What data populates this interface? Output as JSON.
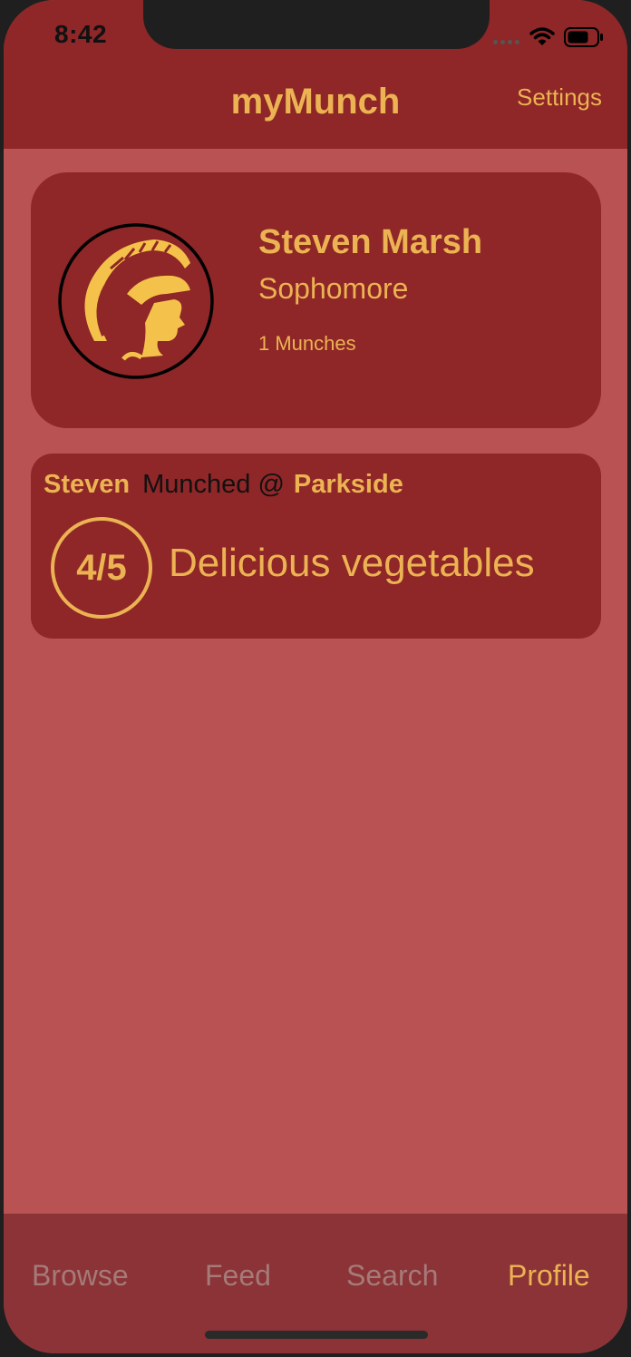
{
  "status_bar": {
    "time": "8:42"
  },
  "nav": {
    "title": "myMunch",
    "settings_label": "Settings"
  },
  "profile": {
    "name": "Steven Marsh",
    "year": "Sophomore",
    "munches": "1 Munches",
    "avatar_icon": "trojan-helmet-icon"
  },
  "post": {
    "user": "Steven",
    "verb": "Munched @",
    "place": "Parkside",
    "rating": "4/5",
    "text": "Delicious vegetables"
  },
  "tabs": [
    {
      "label": "Browse",
      "active": false
    },
    {
      "label": "Feed",
      "active": false
    },
    {
      "label": "Search",
      "active": false
    },
    {
      "label": "Profile",
      "active": true
    }
  ],
  "colors": {
    "header_bg": "#8f2627",
    "page_bg": "#b95253",
    "accent_gold": "#ecb353",
    "tab_bg": "#8b3336",
    "tab_inactive": "#a57a78"
  }
}
